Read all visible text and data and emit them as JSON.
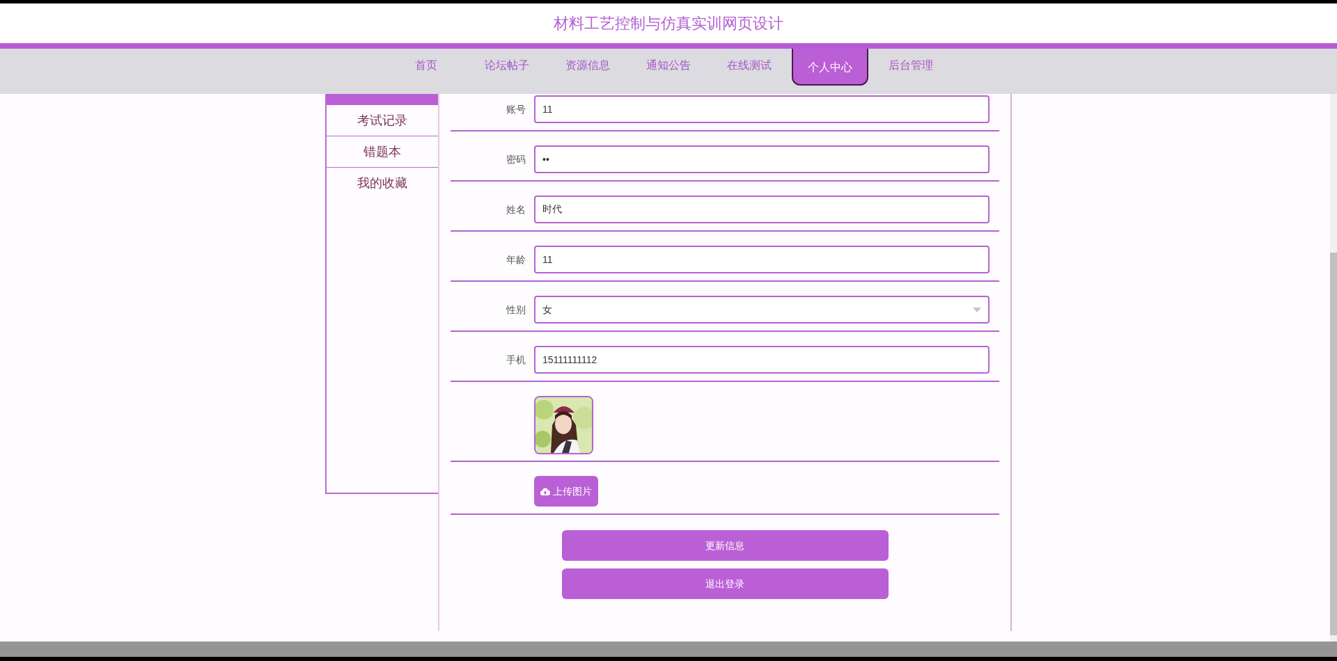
{
  "site_title": "材料工艺控制与仿真实训网页设计",
  "nav": [
    {
      "label": "首页",
      "selected": false
    },
    {
      "label": "论坛帖子",
      "selected": false
    },
    {
      "label": "资源信息",
      "selected": false
    },
    {
      "label": "通知公告",
      "selected": false
    },
    {
      "label": "在线测试",
      "selected": false
    },
    {
      "label": "个人中心",
      "selected": true
    },
    {
      "label": "后台管理",
      "selected": false
    }
  ],
  "sidebar": {
    "items": [
      {
        "label": "考试记录"
      },
      {
        "label": "错题本"
      },
      {
        "label": "我的收藏"
      }
    ]
  },
  "form": {
    "fields": [
      {
        "kind": "text",
        "label": "账号",
        "value": "11"
      },
      {
        "kind": "password",
        "label": "密码",
        "value": "••"
      },
      {
        "kind": "text",
        "label": "姓名",
        "value": "时代"
      },
      {
        "kind": "text",
        "label": "年龄",
        "value": "11"
      },
      {
        "kind": "select",
        "label": "性别",
        "value": "女"
      },
      {
        "kind": "text",
        "label": "手机",
        "value": "15111111112"
      }
    ],
    "avatar": {
      "kind": "picture"
    },
    "upload_button": "上传图片",
    "buttons": [
      "更新信息",
      "退出登录"
    ]
  }
}
